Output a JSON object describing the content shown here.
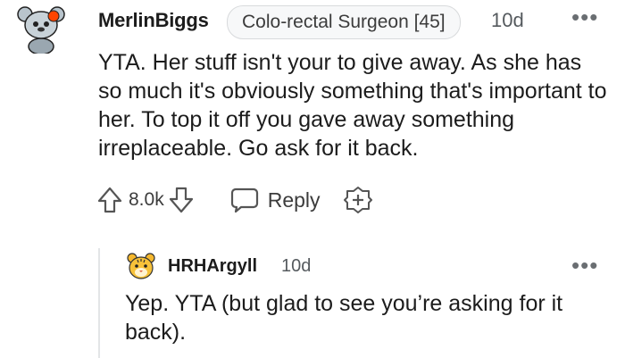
{
  "comment": {
    "username": "MerlinBiggs",
    "flair": "Colo-rectal Surgeon [45]",
    "time": "10d",
    "more": "•••",
    "body": "YTA. Her stuff isn't your to give away. As she has so much it's obviously something that's important to her. To top it off you gave away something irreplaceable. Go ask for it back.",
    "votes": "8.0k",
    "reply_label": "Reply",
    "icons": {
      "avatar": "snoo-avatar-icon",
      "upvote": "upvote-arrow-icon",
      "downvote": "downvote-arrow-icon",
      "reply": "speech-bubble-icon",
      "award": "add-award-icon"
    }
  },
  "reply": {
    "username": "HRHArgyll",
    "time": "10d",
    "more": "•••",
    "body": "Yep. YTA (but glad to see you’re asking for it back).",
    "icons": {
      "avatar": "tiger-avatar-icon"
    }
  },
  "colors": {
    "text": "#1c1c1c",
    "muted": "#555a5e",
    "thread_line": "#e3e5e7",
    "flair_border": "#d8dadc"
  }
}
